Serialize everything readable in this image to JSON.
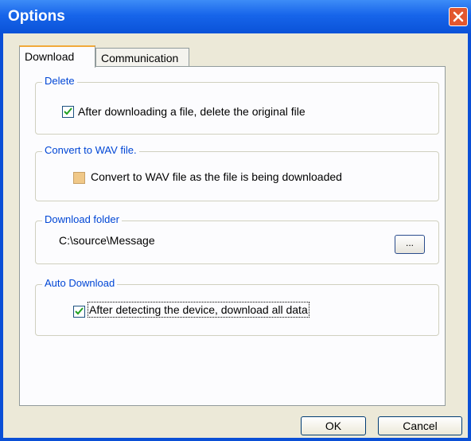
{
  "window": {
    "title": "Options"
  },
  "tabs": [
    {
      "label": "Download",
      "active": true
    },
    {
      "label": "Communication",
      "active": false
    }
  ],
  "groups": {
    "delete": {
      "label": "Delete",
      "checkbox_label": "After downloading a file, delete the original file",
      "checked": true
    },
    "convert": {
      "label": "Convert to WAV file.",
      "checkbox_label": "Convert to WAV file as the file is being downloaded",
      "checked": false
    },
    "folder": {
      "label": "Download folder",
      "path": "C:\\source\\Message",
      "browse_label": "..."
    },
    "auto": {
      "label": "Auto Download",
      "checkbox_label": "After detecting the device, download all data",
      "checked": true
    }
  },
  "buttons": {
    "ok": "OK",
    "cancel": "Cancel"
  },
  "colors": {
    "titlebar": "#0a52d8",
    "group_label": "#0046d5",
    "close_button": "#e2572f"
  },
  "icons": {
    "close": "close-icon",
    "check": "checkmark-icon"
  }
}
